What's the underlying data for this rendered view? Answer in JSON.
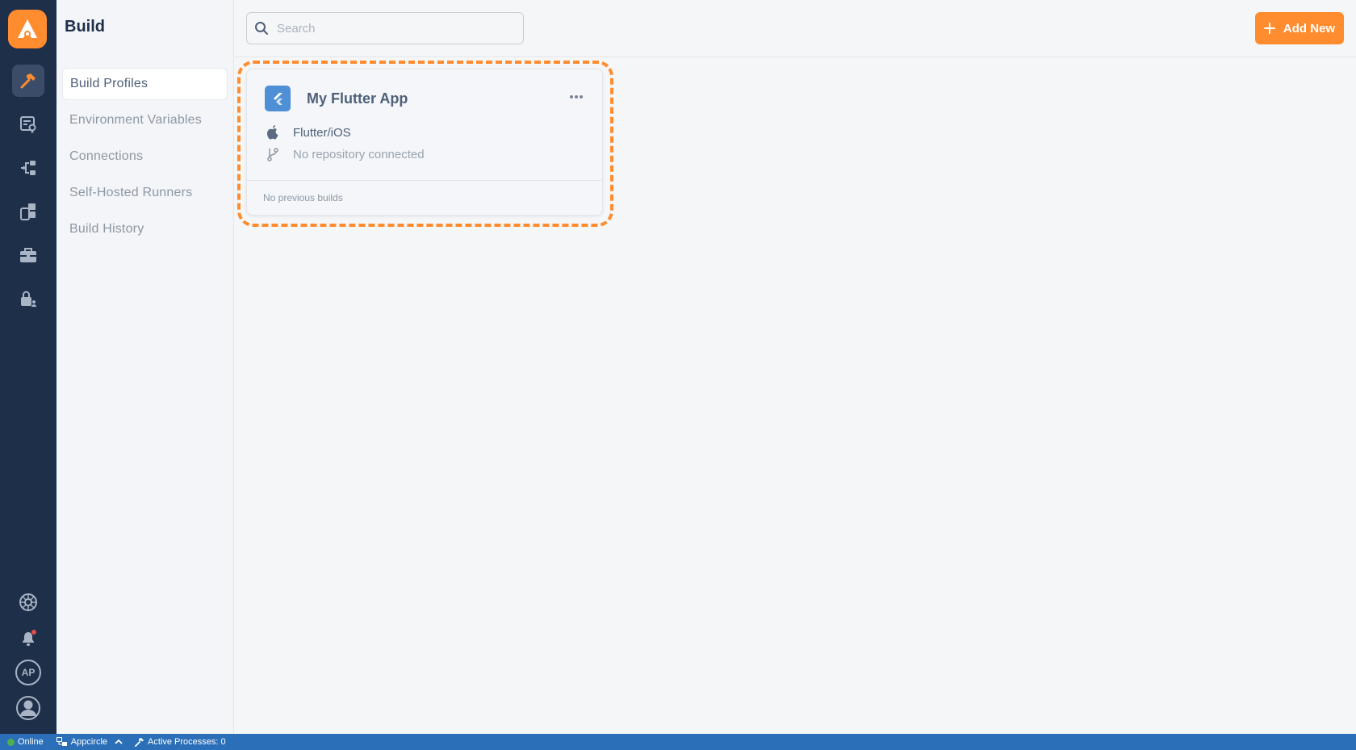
{
  "app": {
    "logo": "appcircle-logo"
  },
  "rail": {
    "items": [
      {
        "icon": "hammer-icon",
        "active": true
      },
      {
        "icon": "signing-identities-icon"
      },
      {
        "icon": "distribution-icon"
      },
      {
        "icon": "testing-distribution-icon"
      },
      {
        "icon": "enterprise-store-icon"
      },
      {
        "icon": "publish-icon"
      }
    ],
    "bottom": [
      {
        "icon": "settings-icon"
      },
      {
        "icon": "notifications-icon"
      },
      {
        "label": "AP"
      },
      {
        "icon": "user-avatar-icon"
      }
    ],
    "avatar_initials": "AP"
  },
  "sidebar": {
    "title": "Build",
    "items": [
      {
        "label": "Build Profiles",
        "active": true
      },
      {
        "label": "Environment Variables"
      },
      {
        "label": "Connections"
      },
      {
        "label": "Self-Hosted Runners"
      },
      {
        "label": "Build History"
      }
    ]
  },
  "topbar": {
    "search_placeholder": "Search",
    "add_button_label": "Add New"
  },
  "card": {
    "app_name": "My Flutter App",
    "platform": "Flutter/iOS",
    "repository": "No repository connected",
    "footer": "No previous builds"
  },
  "statusbar": {
    "online": "Online",
    "organization": "Appcircle",
    "processes": "Active Processes: 0"
  },
  "colors": {
    "accent": "#ff8c2f",
    "rail": "#1e2f4a",
    "statusbar": "#2a6fb8",
    "online": "#4caf50",
    "notification_dot": "#e84a4a"
  }
}
